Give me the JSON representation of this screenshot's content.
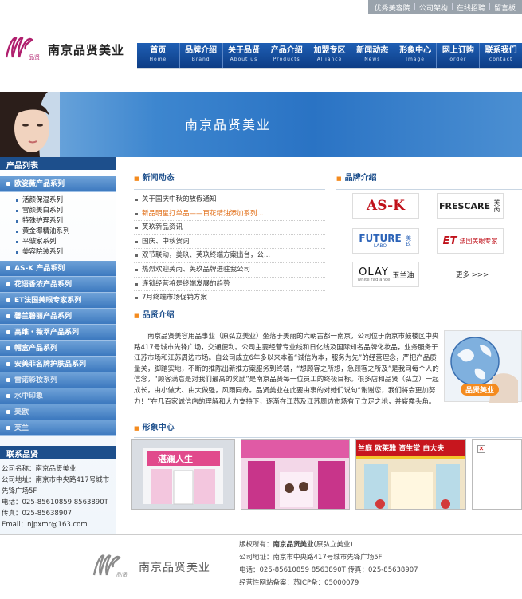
{
  "top_links": [
    "优秀美容院",
    "公司架构",
    "在线招聘",
    "留言板"
  ],
  "site": {
    "name": "南京品贤美业",
    "logo_small": "品贤"
  },
  "nav": [
    {
      "zh": "首页",
      "en": "Home"
    },
    {
      "zh": "品牌介绍",
      "en": "Brand"
    },
    {
      "zh": "关于品贤",
      "en": "About us"
    },
    {
      "zh": "产品介绍",
      "en": "Products"
    },
    {
      "zh": "加盟专区",
      "en": "Alliance"
    },
    {
      "zh": "新闻动态",
      "en": "News"
    },
    {
      "zh": "形象中心",
      "en": "Image"
    },
    {
      "zh": "网上订购",
      "en": "order"
    },
    {
      "zh": "联系我们",
      "en": "contact"
    }
  ],
  "banner": {
    "title": "南京品贤美业"
  },
  "sidebar": {
    "products_title": "产品列表",
    "cat_main": "欧姿薇产品系列",
    "subs": [
      "活颜保湿系列",
      "雪颜美白系列",
      "特殊护理系列",
      "黄金椰精油系列",
      "平皱家系列",
      "美容院装系列"
    ],
    "cats": [
      "AS-K 产品系列",
      "花语香浓产品系列",
      "ET法国美眼专家系列",
      "馨兰碧丽产品系列",
      "高维・薇萃产品系列",
      "帽盒产品系列",
      "安美菲名牌护肤品系列",
      "雷诺彩妆系列",
      "水中印象",
      "美欧",
      "芙兰"
    ],
    "contact_title": "联系品贤",
    "contact": [
      "公司名称：南京品贤美业",
      "公司地址：南京市中央路417号城市先锋广场5F",
      "电话：025-85610859 8563890T",
      "传真：025-85638907",
      "Email：njpxmr@163.com"
    ]
  },
  "news": {
    "title": "新闻动态",
    "items": [
      "关于国庆中秋的放假通知",
      "新品明星打单品——百花精油添加系列...",
      "芙玖新品资讯",
      "国庆、中秋贺词",
      "双节联动，美玖、芙玖终端方案出台，公...",
      "热烈欢迎芙丙、芙玖品牌进驻我公司",
      "连锁经营将是终端发展的趋势",
      "7月终端市场促销方案"
    ]
  },
  "brands": {
    "title": "品牌介绍",
    "items": [
      "AS-K",
      "FRESCARE",
      "芙芮",
      "FUTURE",
      "LABO",
      "美玖",
      "ET",
      "法国美眼专家",
      "OLAY",
      "white radiance",
      "玉兰油"
    ],
    "more": "更多 >>>"
  },
  "about": {
    "title": "品贤介绍",
    "text": "南京品贤美容用品事业（原弘立美业）坐落于美丽的六朝古都一南京，公司位于南京市鼓楼区中央路417号城市先锋广场，交通便利。公司主要经营专业线和日化线及国际知名品牌化妆品，业务服务于江苏市场和江苏周边市场。自公司成立6年多以来本着“诚信为本，服务为先”的经营理念，严把产品质量关，脚踏实地，不断的推陈出新推方案服务到终端，“想顾客之所想，急顾客之所及”是我司每个人的信念，“顾客满意是对我们最高的奖励”是南京品贤每一位员工的终极目标。很多店和品贤（弘立）一起成长，由小做大、由大做强，风雨同舟。品贤美业在此要由衷的对她们说句“谢谢您，我们将会更加努力！”在几百家诚信店的理解和大力支持下，逐渐在江苏及江苏周边市场有了立足之地，并崭露头角。",
    "globe_label": "品贤美业"
  },
  "image_center": {
    "title": "形象中心",
    "store1_sign": "湛澜人生",
    "store3_sign": "兰庭 欧莱雅 资生堂 白大夫"
  },
  "footer": {
    "line1_prefix": "版权所有：",
    "line1_name": "南京品贤美业",
    "line1_suffix": "(原弘立美业)",
    "line2": "公司地址：南京市中央路417号城市先锋广场5F",
    "line3": "电话：025-85610859 8563890T 传真：025-85638907",
    "line4": "经营性网站备案：苏ICP备：05000079",
    "logo_text": "南京品贤美业",
    "logo_small": "品贤"
  },
  "colors": {
    "nav": "#1f5fb4",
    "accent": "#f48b1f",
    "side_cat": "#4f88c9",
    "heading": "#1d4f8c"
  }
}
